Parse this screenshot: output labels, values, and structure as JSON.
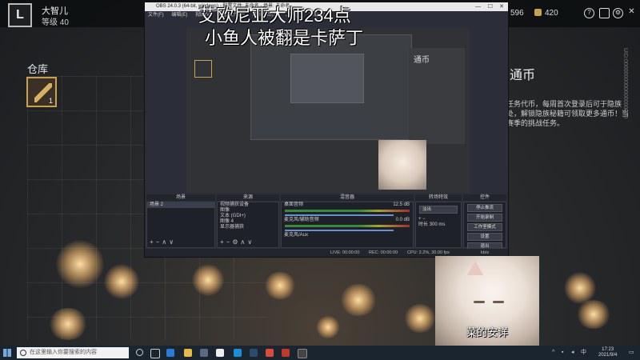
{
  "game": {
    "player_name": "大智儿",
    "player_level": "等级 40",
    "currency1": "596",
    "currency2": "420",
    "warehouse_title": "仓库",
    "item_count": "1",
    "right_title": "通币",
    "right_desc": "任务代币，每周首次登录后可于隐族处，解锁隐族秘籍可领取更多通币！当赛季的挑战任务。",
    "side_vertical": "UID:0000000000000000000"
  },
  "stream_overlay": {
    "line1": "艾欧尼亚大师234点",
    "line2": "小鱼人被翻是卡萨丁"
  },
  "obs": {
    "title": "OBS 24.0.3 (64-bit, windows) - 配置文件: 未命名 - 场景: 未命名",
    "menu": [
      "文件(F)",
      "编辑(E)",
      "视图(V)",
      "配置文件(P)",
      "场景集合(S)",
      "工具(T)",
      "帮助(H)"
    ],
    "preview_side_text": "通币",
    "panels": {
      "scenes_label": "场景",
      "sources_label": "来源",
      "mixer_label": "混音器",
      "transitions_label": "转场特效",
      "controls_label": "控件"
    },
    "scenes": [
      "场景 2"
    ],
    "sources": [
      "视频捕获设备",
      "图像",
      "文本 (GDI+)",
      "图像 4",
      "显示器捕获"
    ],
    "mixer": [
      {
        "name": "桌面音频",
        "db": "12.5 dB"
      },
      {
        "name": "麦克风/辅助音频",
        "db": "0.0 dB"
      },
      {
        "name": "麦克风/Aux",
        "db": ""
      }
    ],
    "transition_type": "淡出",
    "transition_duration_label": "时长",
    "transition_duration": "300 ms",
    "controls": [
      "停止推流",
      "开始录制",
      "工作室模式",
      "设置",
      "退出"
    ],
    "status": {
      "live": "LIVE: 00:00:00",
      "rec": "REC: 00:00:00",
      "cpu": "CPU: 2.2%, 30.00 fps",
      "net": "kb/s"
    }
  },
  "cat_caption": "菜的安详",
  "taskbar": {
    "search_placeholder": "在这里输入你要搜索的内容",
    "time": "17:23",
    "date": "2021/9/4"
  }
}
